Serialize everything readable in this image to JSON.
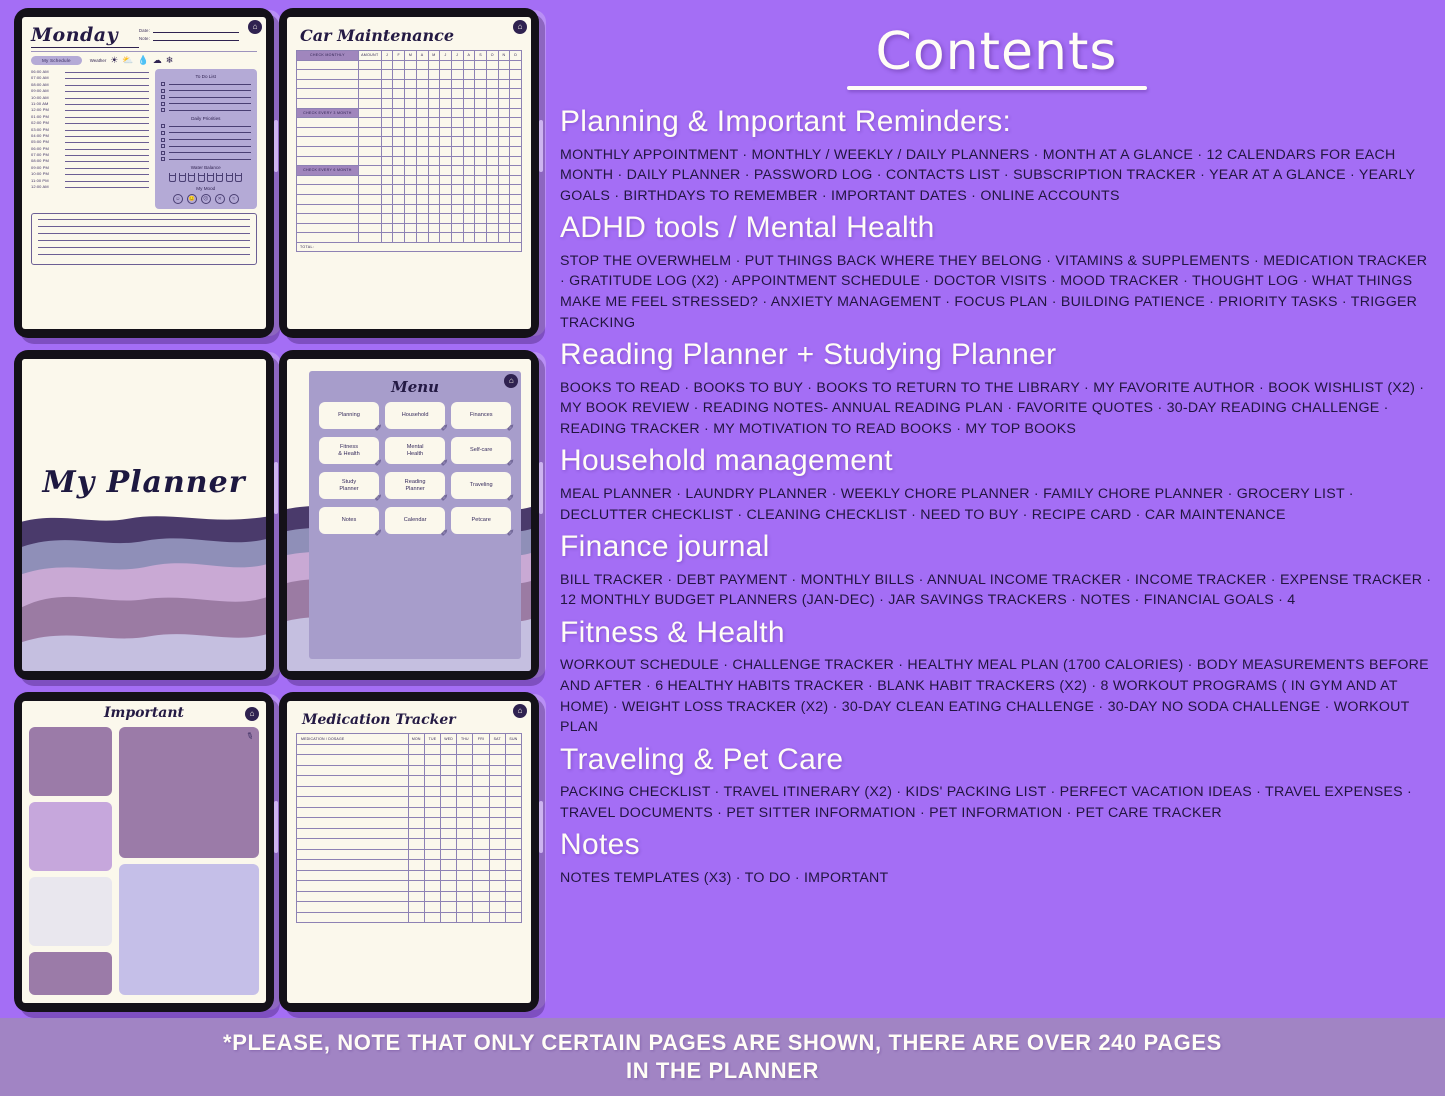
{
  "theme": {
    "background": "#a46ef5",
    "banner_bg": "#a184c4",
    "paper": "#fbf8ec",
    "ink": "#241a44",
    "accent_panel": "#b4aad6",
    "accent_header": "#a086bd"
  },
  "contents": {
    "title": "Contents",
    "sections": [
      {
        "heading": "Planning & Important Reminders:",
        "items": "MONTHLY APPOINTMENT · MONTHLY / WEEKLY / DAILY PLANNERS · MONTH AT A GLANCE · 12 CALENDARS FOR EACH MONTH · DAILY PLANNER · PASSWORD LOG · CONTACTS LIST · SUBSCRIPTION TRACKER · YEAR AT A GLANCE · YEARLY GOALS · BIRTHDAYS TO REMEMBER · IMPORTANT DATES · ONLINE ACCOUNTS"
      },
      {
        "heading": "ADHD tools / Mental Health",
        "items": "STOP THE OVERWHELM · PUT THINGS BACK WHERE THEY BELONG · VITAMINS & SUPPLEMENTS · MEDICATION TRACKER · GRATITUDE LOG (X2) · APPOINTMENT SCHEDULE · DOCTOR VISITS · MOOD TRACKER · THOUGHT LOG · WHAT THINGS MAKE ME FEEL STRESSED? · ANXIETY MANAGEMENT · FOCUS PLAN · BUILDING PATIENCE · PRIORITY TASKS · TRIGGER TRACKING"
      },
      {
        "heading": "Reading Planner + Studying Planner",
        "items": "BOOKS TO READ · BOOKS TO BUY · BOOKS TO RETURN TO THE LIBRARY · MY FAVORITE AUTHOR · BOOK WISHLIST (X2) · MY BOOK REVIEW · READING NOTES- ANNUAL READING PLAN · FAVORITE QUOTES · 30-DAY READING CHALLENGE · READING TRACKER · MY MOTIVATION TO READ BOOKS · MY TOP BOOKS"
      },
      {
        "heading": "Household management",
        "items": "MEAL PLANNER · LAUNDRY PLANNER · WEEKLY CHORE PLANNER · FAMILY CHORE PLANNER · GROCERY LIST · DECLUTTER CHECKLIST · CLEANING CHECKLIST · NEED TO BUY · RECIPE CARD · CAR MAINTENANCE"
      },
      {
        "heading": "Finance journal",
        "items": "BILL TRACKER · DEBT PAYMENT · MONTHLY BILLS · ANNUAL INCOME TRACKER · INCOME TRACKER · EXPENSE TRACKER · 12 MONTHLY BUDGET PLANNERS (JAN-DEC) · JAR SAVINGS TRACKERS · NOTES · FINANCIAL GOALS · 4"
      },
      {
        "heading": "Fitness & Health",
        "items": "WORKOUT SCHEDULE · CHALLENGE TRACKER · HEALTHY MEAL PLAN (1700 CALORIES) · BODY MEASUREMENTS BEFORE AND AFTER · 6 HEALTHY HABITS TRACKER · BLANK HABIT TRACKERS (X2) · 8 WORKOUT PROGRAMS ( IN GYM AND AT HOME) · WEIGHT LOSS TRACKER (X2) · 30-DAY CLEAN EATING CHALLENGE · 30-DAY NO SODA CHALLENGE · WORKOUT PLAN"
      },
      {
        "heading": "Traveling & Pet Care",
        "items": "PACKING CHECKLIST · TRAVEL ITINERARY (X2) · KIDS' PACKING LIST · PERFECT VACATION IDEAS · TRAVEL EXPENSES · TRAVEL DOCUMENTS · PET SITTER INFORMATION · PET INFORMATION · PET CARE TRACKER"
      },
      {
        "heading": "Notes",
        "items": "NOTES TEMPLATES (X3) · TO DO · IMPORTANT"
      }
    ]
  },
  "banner": {
    "line1": "*PLEASE, NOTE THAT ONLY CERTAIN PAGES ARE SHOWN, THERE ARE OVER 240 PAGES",
    "line2": "IN THE PLANNER"
  },
  "tablets": {
    "daily": {
      "title": "Monday",
      "date_label": "Date:",
      "note_label": "Note:",
      "schedule_pill": "My Schedule",
      "weather_label": "Weather",
      "weather_icons": [
        "sun-icon",
        "sun-cloud-icon",
        "raindrop-icon",
        "cloud-icon",
        "snowflake-icon"
      ],
      "times": [
        "06:00 AM",
        "07:00 AM",
        "08:00 AM",
        "09:00 AM",
        "10:00 AM",
        "11:00 AM",
        "12:00 PM",
        "01:00 PM",
        "02:00 PM",
        "03:00 PM",
        "04:00 PM",
        "05:00 PM",
        "06:00 PM",
        "07:00 PM",
        "08:00 PM",
        "09:00 PM",
        "10:00 PM",
        "11:00 PM",
        "12:00 AM"
      ],
      "todo_title": "To Do List",
      "todo_rows": 5,
      "priorities_title": "Daily Priorities",
      "priorities_rows": 6,
      "water_title": "Water Balance",
      "water_glasses": 8,
      "mood_title": "My Mood",
      "mood_faces": [
        "happy-face-icon",
        "neutral-face-icon",
        "sad-face-icon",
        "angry-face-icon",
        "tired-face-icon"
      ],
      "notes_lines": 6,
      "home_icon": "home-icon"
    },
    "car": {
      "title": "Car Maintenance",
      "col_check_monthly": "CHECK MONTHLY",
      "col_amount": "AMOUNT",
      "months": [
        "J",
        "F",
        "M",
        "A",
        "M",
        "J",
        "J",
        "A",
        "S",
        "O",
        "N",
        "D"
      ],
      "section_3month": "CHECK EVERY 3 MONTH",
      "section_6month": "CHECK EVERY 6 MONTH",
      "total_label": "TOTAL:",
      "rows_monthly": 5,
      "rows_3month": 5,
      "rows_6month": 7,
      "home_icon": "home-icon"
    },
    "cover": {
      "title": "My Planner",
      "wave_colors": [
        "#4a3a6b",
        "#8f8fb8",
        "#c9a9d4",
        "#9b7ba3",
        "#c5bfe0"
      ]
    },
    "menu": {
      "title": "Menu",
      "home_icon": "home-icon",
      "buttons": [
        {
          "label": "Planning",
          "icon": "calendar-icon"
        },
        {
          "label": "Household",
          "icon": "house-icon"
        },
        {
          "label": "Finances",
          "icon": "coins-icon"
        },
        {
          "label": "Fitness\n& Health",
          "icon": "dumbbell-icon"
        },
        {
          "label": "Mental\nHealth",
          "icon": "heart-icon"
        },
        {
          "label": "Self-care",
          "icon": "hands-heart-icon"
        },
        {
          "label": "Study\nPlanner",
          "icon": "pen-icon"
        },
        {
          "label": "Reading\nPlanner",
          "icon": "book-icon"
        },
        {
          "label": "Traveling",
          "icon": "plane-icon"
        },
        {
          "label": "Notes",
          "icon": "notepad-icon"
        },
        {
          "label": "Calendar",
          "icon": "calendar-grid-icon"
        },
        {
          "label": "Petcare",
          "icon": "dog-icon"
        }
      ]
    },
    "important": {
      "title": "Important",
      "home_icon": "home-icon",
      "pin_icon": "pushpin-icon",
      "left_swatches": [
        "#9b7ba8",
        "#c6a7dc",
        "#e9e7ee",
        "#9b7ba8"
      ],
      "right_swatches": [
        "#9b7ba8",
        "#c5bfe8"
      ]
    },
    "medication": {
      "title": "Medication Tracker",
      "col_medication": "MEDICATION / DOSAGE",
      "days": [
        "MON",
        "TUE",
        "WED",
        "THU",
        "FRI",
        "SAT",
        "SUN"
      ],
      "rows": 17,
      "home_icon": "home-icon"
    }
  }
}
